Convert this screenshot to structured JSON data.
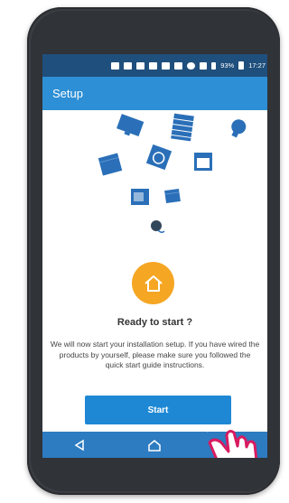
{
  "status_bar": {
    "battery": "93%",
    "time": "17:27"
  },
  "app_bar": {
    "title": "Setup"
  },
  "devices": [
    {
      "icon": "tv-icon"
    },
    {
      "icon": "shutter-icon"
    },
    {
      "icon": "light-bulb-icon"
    },
    {
      "icon": "box-icon"
    },
    {
      "icon": "washing-machine-icon"
    },
    {
      "icon": "oven-icon"
    },
    {
      "icon": "microwave-icon"
    },
    {
      "icon": "small-box-icon"
    },
    {
      "icon": "plug-icon"
    }
  ],
  "main": {
    "home_icon": "home-icon",
    "title": "Ready to start ?",
    "description": "We will now start your installation setup. If you have wired the products by yourself, please make sure you followed the quick start guide instructions.",
    "start_label": "Start"
  },
  "nav": {
    "back_icon": "back-icon",
    "home_icon": "home-nav-icon"
  },
  "colors": {
    "status_bar": "#1f4f7d",
    "app_bar": "#2d8fd5",
    "accent_orange": "#f5a623",
    "button": "#1e88d4",
    "nav_bar": "#2d7bc0",
    "device_blue": "#2a6fb8"
  }
}
